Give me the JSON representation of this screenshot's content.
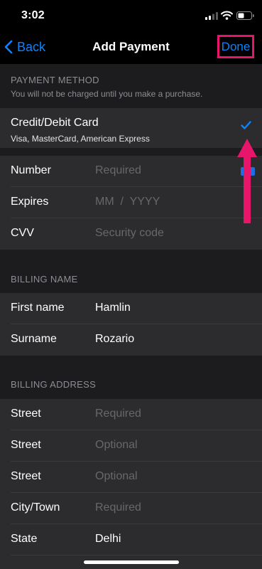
{
  "status_bar": {
    "time": "3:02"
  },
  "nav": {
    "back_label": "Back",
    "title": "Add Payment",
    "done_label": "Done"
  },
  "payment_method": {
    "header": "PAYMENT METHOD",
    "note": "You will not be charged until you make a purchase.",
    "card_title": "Credit/Debit Card",
    "card_sub": "Visa, MasterCard, American Express"
  },
  "card_fields": {
    "number": {
      "label": "Number",
      "placeholder": "Required"
    },
    "expires": {
      "label": "Expires",
      "placeholder": "MM  /  YYYY"
    },
    "cvv": {
      "label": "CVV",
      "placeholder": "Security code"
    }
  },
  "billing_name": {
    "header": "BILLING NAME",
    "first": {
      "label": "First name",
      "value": "Hamlin"
    },
    "surname": {
      "label": "Surname",
      "value": "Rozario"
    }
  },
  "billing_address": {
    "header": "BILLING ADDRESS",
    "rows": [
      {
        "label": "Street",
        "placeholder": "Required"
      },
      {
        "label": "Street",
        "placeholder": "Optional"
      },
      {
        "label": "Street",
        "placeholder": "Optional"
      },
      {
        "label": "City/Town",
        "placeholder": "Required"
      },
      {
        "label": "State",
        "value": "Delhi"
      }
    ]
  },
  "colors": {
    "accent": "#0a84ff",
    "highlight": "#e8166a",
    "background": "#1c1c1e",
    "cell": "#2c2c2e"
  }
}
